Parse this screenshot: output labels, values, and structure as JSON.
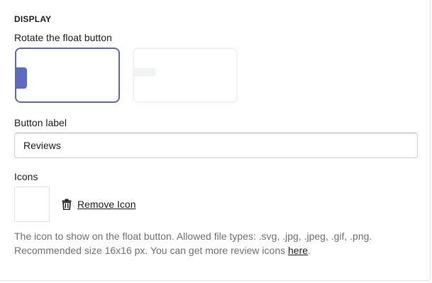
{
  "display": {
    "heading": "DISPLAY",
    "rotate_label": "Rotate the float button",
    "rotate_options": [
      {
        "name": "vertical",
        "selected": true
      },
      {
        "name": "horizontal",
        "selected": false
      }
    ],
    "accent_color": "#5c6ac4"
  },
  "button_label": {
    "label": "Button label",
    "value": "Reviews"
  },
  "icons": {
    "label": "Icons",
    "remove_label": "Remove Icon",
    "help_text_1": "The icon to show on the float button. Allowed file types: .svg, .jpg, .jpeg, .gif, .png.",
    "help_text_2": "Recommended size 16x16 px. You can get more review icons ",
    "help_link": "here",
    "help_end": "."
  }
}
